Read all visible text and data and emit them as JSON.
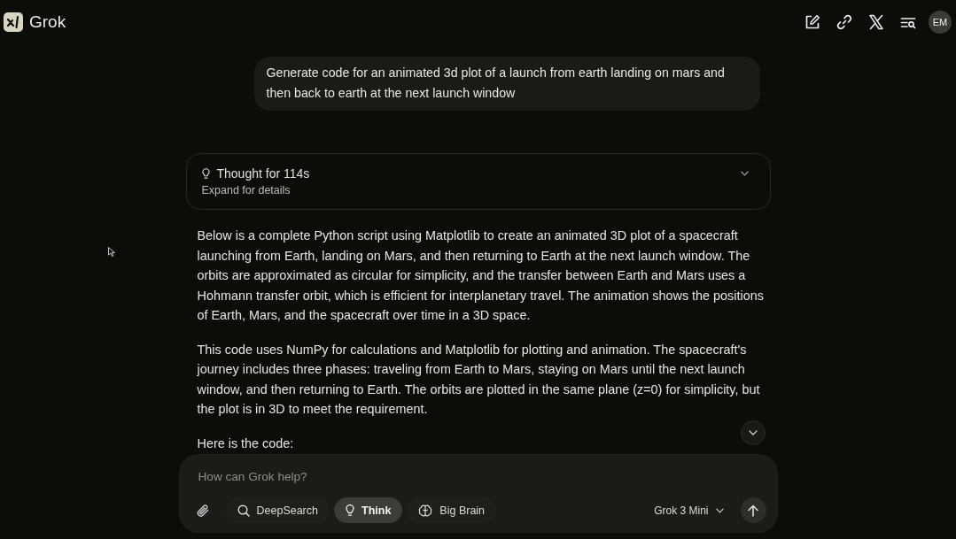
{
  "header": {
    "logo_text": "Grok",
    "avatar_initials": "EM"
  },
  "conversation": {
    "user_message": "Generate code for an animated 3d plot of a launch from earth landing on mars and then back to earth at the next launch window",
    "thought": {
      "title": "Thought for 114s",
      "subtitle": "Expand for details",
      "expanded": false
    },
    "paragraphs": [
      "Below is a complete Python script using Matplotlib to create an animated 3D plot of a spacecraft launching from Earth, landing on Mars, and then returning to Earth at the next launch window. The orbits are approximated as circular for simplicity, and the transfer between Earth and Mars uses a Hohmann transfer orbit, which is efficient for interplanetary travel. The animation shows the positions of Earth, Mars, and the spacecraft over time in a 3D space.",
      "This code uses NumPy for calculations and Matplotlib for plotting and animation. The spacecraft's journey includes three phases: traveling from Earth to Mars, staying on Mars until the next launch window, and then returning to Earth. The orbits are plotted in the same plane (z=0) for simplicity, but the plot is in 3D to meet the requirement.",
      "Here is the code:"
    ]
  },
  "composer": {
    "placeholder": "How can Grok help?",
    "tools": [
      {
        "kind": "search",
        "label": "DeepSearch",
        "selected": false
      },
      {
        "kind": "think",
        "label": "Think",
        "selected": true
      },
      {
        "kind": "brain",
        "label": "Big Brain",
        "selected": false
      }
    ],
    "model": "Grok 3 Mini"
  }
}
